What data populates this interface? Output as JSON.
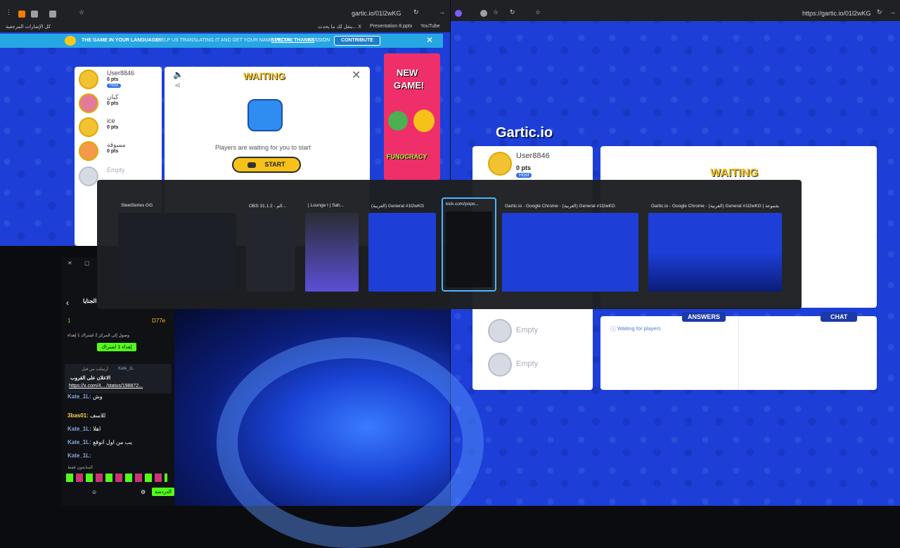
{
  "left_browser": {
    "url": "gartic.io/01l2wKG",
    "bookmarks": [
      "كل الإشارات المرجعية",
      "ينقل لك ما يحدث... X",
      "Presentation 8.pptx",
      "YouTube"
    ],
    "banner": {
      "title": "THE GAME IN YOUR LANGUAGE!",
      "text": "HELP US TRANSLATING IT AND GET YOUR NAME ON THE",
      "link": "SPECIAL THANKS",
      "tail": "SESSION",
      "button": "CONTRIBUTE"
    },
    "players": [
      {
        "name": "User8846",
        "pts": "0 pts",
        "badge": "Host"
      },
      {
        "name": "كيان",
        "pts": "0 pts"
      },
      {
        "name": "ice",
        "pts": "0 pts"
      },
      {
        "name": "مسوقة",
        "pts": "0 pts"
      },
      {
        "name": "Empty"
      }
    ],
    "waiting": {
      "title": "WAITING",
      "text": "Players are waiting for you to start",
      "button": "START"
    },
    "ad": [
      "NEW",
      "GAME!",
      "FUNOCRACY"
    ]
  },
  "right_browser": {
    "url": "https://gartic.io/01l2wKG",
    "logo": "Gartic.io",
    "players": [
      {
        "name": "User8846",
        "pts": "0 pts",
        "badge": "Host"
      },
      {
        "name": "Empty"
      },
      {
        "name": "Empty"
      }
    ],
    "waiting_title": "WAITING",
    "answers_label": "ANSWERS",
    "chat_label": "CHAT",
    "waiting_players": "Waiting for players"
  },
  "switcher": [
    {
      "title": "SteelSeries GG"
    },
    {
      "title": "OBS 31.1.2 - الم..."
    },
    {
      "title": "| Lounge I | Sah..."
    },
    {
      "title": "(العربية) General #1l2wKG"
    },
    {
      "title": "kick.com/popo..."
    },
    {
      "title": "Gartic.io - Google Chrome - (العربية) General #1l2wKG"
    },
    {
      "title": "Gartic.io - Google Chrome - (العربية) General #1l2wKG | مجموعة"
    }
  ],
  "kick": {
    "header": "الجنايا",
    "count": "1",
    "user": "D77e",
    "line1": "وصول إلى المركز 2 اشتراك 1 إهداء",
    "gift_button": "إهداء 1 اشتراك",
    "pinned_user": "Kate_1L",
    "pinned_prefix": "أرسلت من قبل",
    "pinned_text": "الاعلان على القروب",
    "pinned_link": "https://x.com/4... /status/198872...",
    "messages": [
      {
        "user": "Kate_1L:",
        "text": "وش"
      },
      {
        "user": "3bas01:",
        "text": "للاسف"
      },
      {
        "user": "Kate_1L:",
        "text": "اهلا"
      },
      {
        "user": "Kate_1L:",
        "text": "يب من اول اتوقع"
      },
      {
        "user": "Kate_1L:",
        "text": ""
      }
    ],
    "bottom_label": "المتابعون فقط",
    "chat_button": "الدردشة"
  }
}
